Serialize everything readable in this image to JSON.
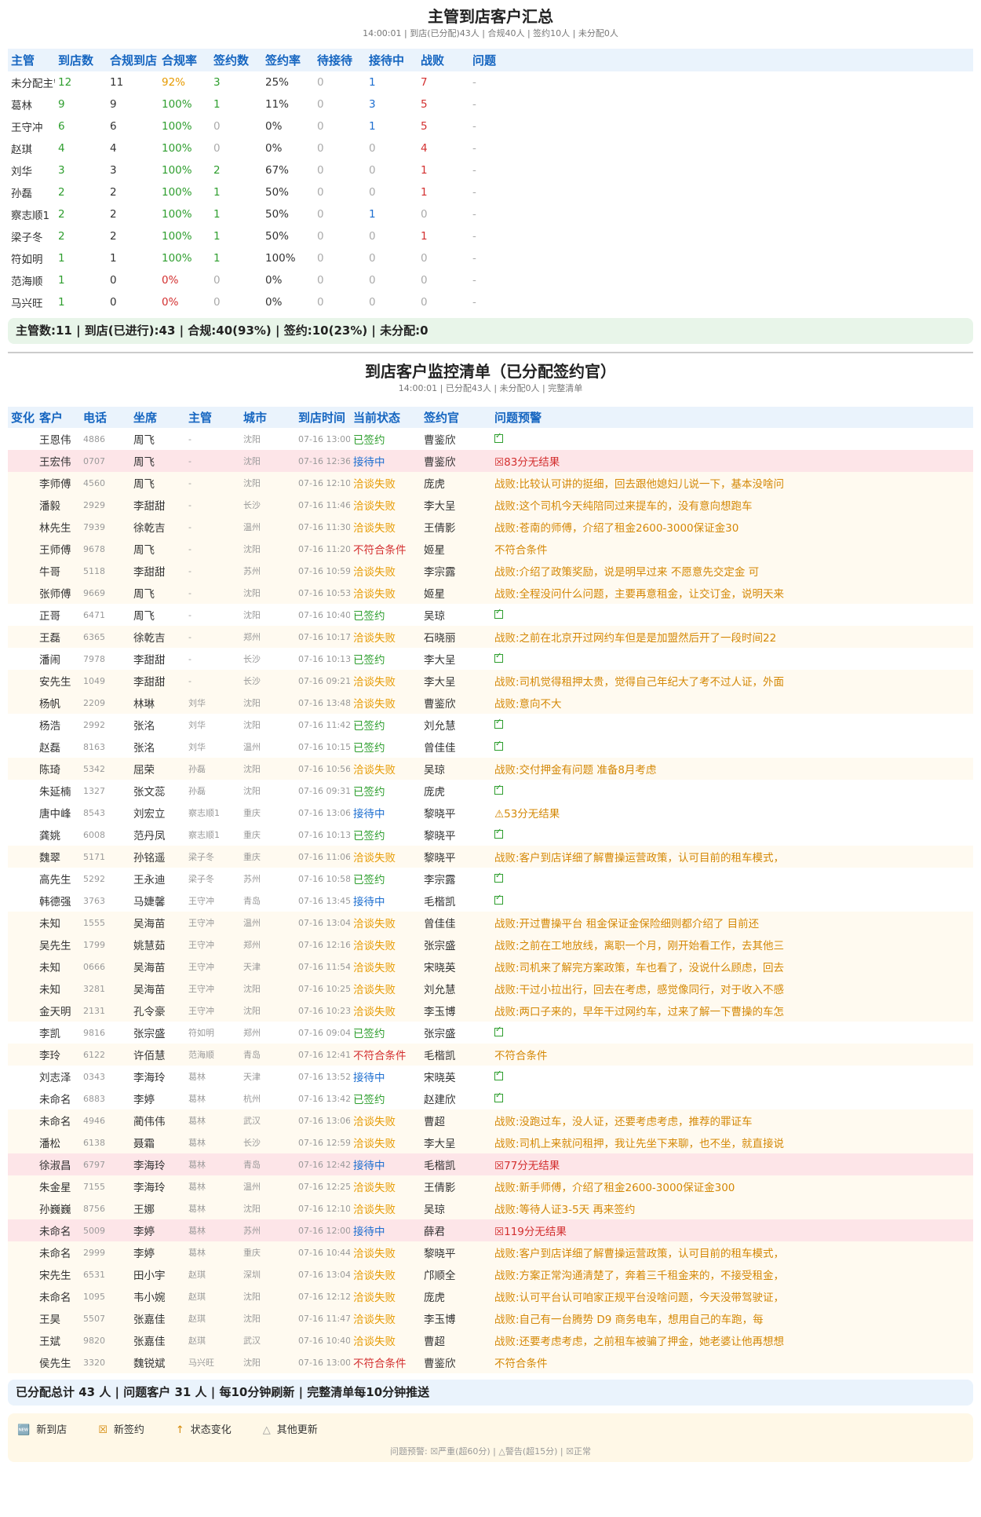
{
  "summary": {
    "title": "主管到店客户汇总",
    "subtitle": "14:00:01 | 到店(已分配)43人 | 合规40人 | 签约10人 | 未分配0人",
    "headers": [
      "主管",
      "到店数",
      "合规到店",
      "合规率",
      "签约数",
      "签约率",
      "待接待",
      "接待中",
      "战败",
      "问题"
    ],
    "rows": [
      [
        "未分配主管",
        "12",
        "11",
        "92%",
        "3",
        "25%",
        "0",
        "1",
        "7",
        "-"
      ],
      [
        "葛林",
        "9",
        "9",
        "100%",
        "1",
        "11%",
        "0",
        "3",
        "5",
        "-"
      ],
      [
        "王守冲",
        "6",
        "6",
        "100%",
        "0",
        "0%",
        "0",
        "1",
        "5",
        "-"
      ],
      [
        "赵琪",
        "4",
        "4",
        "100%",
        "0",
        "0%",
        "0",
        "0",
        "4",
        "-"
      ],
      [
        "刘华",
        "3",
        "3",
        "100%",
        "2",
        "67%",
        "0",
        "0",
        "1",
        "-"
      ],
      [
        "孙磊",
        "2",
        "2",
        "100%",
        "1",
        "50%",
        "0",
        "0",
        "1",
        "-"
      ],
      [
        "察志顺1",
        "2",
        "2",
        "100%",
        "1",
        "50%",
        "0",
        "1",
        "0",
        "-"
      ],
      [
        "梁子冬",
        "2",
        "2",
        "100%",
        "1",
        "50%",
        "0",
        "0",
        "1",
        "-"
      ],
      [
        "符如明",
        "1",
        "1",
        "100%",
        "1",
        "100%",
        "0",
        "0",
        "0",
        "-"
      ],
      [
        "范海顺",
        "1",
        "0",
        "0%",
        "0",
        "0%",
        "0",
        "0",
        "0",
        "-"
      ],
      [
        "马兴旺",
        "1",
        "0",
        "0%",
        "0",
        "0%",
        "0",
        "0",
        "0",
        "-"
      ]
    ],
    "footer": "主管数:11 | 到店(已进行):43 | 合规:40(93%) | 签约:10(23%) | 未分配:0"
  },
  "monitor": {
    "title": "到店客户监控清单（已分配签约官）",
    "subtitle": "14:00:01 | 已分配43人 | 未分配0人 | 完整清单",
    "headers": [
      "变化",
      "客户",
      "电话",
      "坐席",
      "主管",
      "城市",
      "到店时间",
      "当前状态",
      "签约官",
      "问题预警"
    ],
    "rows": [
      [
        "",
        "王恩伟",
        "4886",
        "周飞",
        "-",
        "沈阳",
        "07-16 13:00",
        "已签约",
        "曹鉴欣",
        "",
        "ok"
      ],
      [
        "",
        "王宏伟",
        "0707",
        "周飞",
        "-",
        "沈阳",
        "07-16 12:36",
        "接待中",
        "曹鉴欣",
        "83分无结果",
        "hl"
      ],
      [
        "",
        "李师傅",
        "4560",
        "周飞",
        "-",
        "沈阳",
        "07-16 12:10",
        "洽谈失败",
        "庞虎",
        "战败:比较认可讲的挺细，回去跟他媳妇儿说一下，基本没啥问",
        "alt"
      ],
      [
        "",
        "潘毅",
        "2929",
        "李甜甜",
        "-",
        "长沙",
        "07-16 11:46",
        "洽谈失败",
        "李大呈",
        "战败:这个司机今天纯陪同过来提车的，没有意向想跑车",
        "alt"
      ],
      [
        "",
        "林先生",
        "7939",
        "徐乾吉",
        "-",
        "温州",
        "07-16 11:30",
        "洽谈失败",
        "王倩影",
        "战败:苍南的师傅，介绍了租金2600-3000保证金30",
        "alt"
      ],
      [
        "",
        "王师傅",
        "9678",
        "周飞",
        "-",
        "沈阳",
        "07-16 11:20",
        "不符合条件",
        "姬星",
        "不符合条件",
        "alt"
      ],
      [
        "",
        "牛哥",
        "5118",
        "李甜甜",
        "-",
        "苏州",
        "07-16 10:59",
        "洽谈失败",
        "李宗露",
        "战败:介绍了政策奖励，说是明早过来 不愿意先交定金 可",
        "alt"
      ],
      [
        "",
        "张师傅",
        "9669",
        "周飞",
        "-",
        "沈阳",
        "07-16 10:53",
        "洽谈失败",
        "姬星",
        "战败:全程没问什么问题，主要再意租金，让交订金，说明天来",
        "alt"
      ],
      [
        "",
        "正哥",
        "6471",
        "周飞",
        "-",
        "沈阳",
        "07-16 10:40",
        "已签约",
        "吴琼",
        "",
        "ok"
      ],
      [
        "",
        "王磊",
        "6365",
        "徐乾吉",
        "-",
        "郑州",
        "07-16 10:17",
        "洽谈失败",
        "石晓丽",
        "战败:之前在北京开过网约车但是是加盟然后开了一段时间22",
        "alt"
      ],
      [
        "",
        "潘闹",
        "7978",
        "李甜甜",
        "-",
        "长沙",
        "07-16 10:13",
        "已签约",
        "李大呈",
        "",
        "ok"
      ],
      [
        "",
        "安先生",
        "1049",
        "李甜甜",
        "-",
        "长沙",
        "07-16 09:21",
        "洽谈失败",
        "李大呈",
        "战败:司机觉得租押太贵，觉得自己年纪大了考不过人证，外面",
        "alt"
      ],
      [
        "",
        "杨帆",
        "2209",
        "林琳",
        "刘华",
        "沈阳",
        "07-16 13:48",
        "洽谈失败",
        "曹鉴欣",
        "战败:意向不大",
        "alt"
      ],
      [
        "",
        "杨浩",
        "2992",
        "张洺",
        "刘华",
        "沈阳",
        "07-16 11:42",
        "已签约",
        "刘允慧",
        "",
        "ok"
      ],
      [
        "",
        "赵磊",
        "8163",
        "张洺",
        "刘华",
        "温州",
        "07-16 10:15",
        "已签约",
        "曾佳佳",
        "",
        "ok"
      ],
      [
        "",
        "陈琦",
        "5342",
        "屈荣",
        "孙磊",
        "沈阳",
        "07-16 10:56",
        "洽谈失败",
        "吴琼",
        "战败:交付押金有问题 准备8月考虑",
        "alt"
      ],
      [
        "",
        "朱延楠",
        "1327",
        "张文蕊",
        "孙磊",
        "沈阳",
        "07-16 09:31",
        "已签约",
        "庞虎",
        "",
        "ok"
      ],
      [
        "",
        "唐中峰",
        "8543",
        "刘宏立",
        "察志顺1",
        "重庆",
        "07-16 13:06",
        "接待中",
        "黎晓平",
        "53分无结果",
        "warn"
      ],
      [
        "",
        "龚姚",
        "6008",
        "范丹凤",
        "察志顺1",
        "重庆",
        "07-16 10:13",
        "已签约",
        "黎晓平",
        "",
        "ok"
      ],
      [
        "",
        "魏翠",
        "5171",
        "孙铭遥",
        "梁子冬",
        "重庆",
        "07-16 11:06",
        "洽谈失败",
        "黎晓平",
        "战败:客户到店详细了解曹操运营政策，认可目前的租车模式，",
        "alt"
      ],
      [
        "",
        "高先生",
        "5292",
        "王永迪",
        "梁子冬",
        "苏州",
        "07-16 10:58",
        "已签约",
        "李宗露",
        "",
        "ok"
      ],
      [
        "",
        "韩德强",
        "3763",
        "马婕馨",
        "王守冲",
        "青岛",
        "07-16 13:45",
        "接待中",
        "毛楷凯",
        "",
        "ok"
      ],
      [
        "",
        "未知",
        "1555",
        "吴海苗",
        "王守冲",
        "温州",
        "07-16 13:04",
        "洽谈失败",
        "曾佳佳",
        "战败:开过曹操平台 租金保证金保险细则都介绍了 目前还",
        "alt"
      ],
      [
        "",
        "吴先生",
        "1799",
        "姚慧茹",
        "王守冲",
        "郑州",
        "07-16 12:16",
        "洽谈失败",
        "张宗盛",
        "战败:之前在工地放线，离职一个月，刚开始看工作，去其他三",
        "alt"
      ],
      [
        "",
        "未知",
        "0666",
        "吴海苗",
        "王守冲",
        "天津",
        "07-16 11:54",
        "洽谈失败",
        "宋晓英",
        "战败:司机来了解完方案政策，车也看了，没说什么顾虑，回去",
        "alt"
      ],
      [
        "",
        "未知",
        "3281",
        "吴海苗",
        "王守冲",
        "沈阳",
        "07-16 10:25",
        "洽谈失败",
        "刘允慧",
        "战败:干过小拉出行，回去在考虑，感觉像同行，对于收入不感",
        "alt"
      ],
      [
        "",
        "金天明",
        "2131",
        "孔令豪",
        "王守冲",
        "沈阳",
        "07-16 10:23",
        "洽谈失败",
        "李玉博",
        "战败:两口子来的，早年干过网约车，过来了解一下曹操的车怎",
        "alt"
      ],
      [
        "",
        "李凯",
        "9816",
        "张宗盛",
        "符如明",
        "郑州",
        "07-16 09:04",
        "已签约",
        "张宗盛",
        "",
        "ok"
      ],
      [
        "",
        "李玲",
        "6122",
        "许佰慧",
        "范海顺",
        "青岛",
        "07-16 12:41",
        "不符合条件",
        "毛楷凯",
        "不符合条件",
        "alt"
      ],
      [
        "",
        "刘志泽",
        "0343",
        "李海玲",
        "葛林",
        "天津",
        "07-16 13:52",
        "接待中",
        "宋晓英",
        "",
        "ok"
      ],
      [
        "",
        "未命名",
        "6883",
        "李婷",
        "葛林",
        "杭州",
        "07-16 13:42",
        "已签约",
        "赵建欣",
        "",
        "ok"
      ],
      [
        "",
        "未命名",
        "4946",
        "蔺伟伟",
        "葛林",
        "武汉",
        "07-16 13:06",
        "洽谈失败",
        "曹超",
        "战败:没跑过车，没人证，还要考虑考虑，推荐的罪证车",
        "alt"
      ],
      [
        "",
        "潘松",
        "6138",
        "聂霜",
        "葛林",
        "长沙",
        "07-16 12:59",
        "洽谈失败",
        "李大呈",
        "战败:司机上来就问租押，我让先坐下来聊，也不坐，就直接说",
        "alt"
      ],
      [
        "",
        "徐淑昌",
        "6797",
        "李海玲",
        "葛林",
        "青岛",
        "07-16 12:42",
        "接待中",
        "毛楷凯",
        "77分无结果",
        "hl"
      ],
      [
        "",
        "朱金星",
        "7155",
        "李海玲",
        "葛林",
        "温州",
        "07-16 12:25",
        "洽谈失败",
        "王倩影",
        "战败:新手师傅，介绍了租金2600-3000保证金300",
        "alt"
      ],
      [
        "",
        "孙巍巍",
        "8756",
        "王娜",
        "葛林",
        "沈阳",
        "07-16 12:10",
        "洽谈失败",
        "吴琼",
        "战败:等待人证3-5天 再来签约",
        "alt"
      ],
      [
        "",
        "未命名",
        "5009",
        "李婷",
        "葛林",
        "苏州",
        "07-16 12:00",
        "接待中",
        "薛君",
        "119分无结果",
        "hl"
      ],
      [
        "",
        "未命名",
        "2999",
        "李婷",
        "葛林",
        "重庆",
        "07-16 10:44",
        "洽谈失败",
        "黎晓平",
        "战败:客户到店详细了解曹操运营政策，认可目前的租车模式，",
        "alt"
      ],
      [
        "",
        "宋先生",
        "6531",
        "田小宇",
        "赵琪",
        "深圳",
        "07-16 13:04",
        "洽谈失败",
        "邝顺全",
        "战败:方案正常沟通清楚了，奔着三千租金来的，不接受租金，",
        "alt"
      ],
      [
        "",
        "未命名",
        "1095",
        "韦小婉",
        "赵琪",
        "沈阳",
        "07-16 12:12",
        "洽谈失败",
        "庞虎",
        "战败:认可平台认可咱家正规平台没啥问题，今天没带驾驶证，",
        "alt"
      ],
      [
        "",
        "王昊",
        "5507",
        "张嘉佳",
        "赵琪",
        "沈阳",
        "07-16 11:47",
        "洽谈失败",
        "李玉博",
        "战败:自己有一台腾势 D9 商务电车，想用自己的车跑，每",
        "alt"
      ],
      [
        "",
        "王斌",
        "9820",
        "张嘉佳",
        "赵琪",
        "武汉",
        "07-16 10:40",
        "洽谈失败",
        "曹超",
        "战败:还要考虑考虑，之前租车被骗了押金，她老婆让他再想想",
        "alt"
      ],
      [
        "",
        "侯先生",
        "3320",
        "魏锐斌",
        "马兴旺",
        "沈阳",
        "07-16 13:00",
        "不符合条件",
        "曹鉴欣",
        "不符合条件",
        "alt"
      ]
    ],
    "footer": "已分配总计 43 人 | 问题客户 31 人 | 每10分钟刷新 | 完整清单每10分钟推送"
  },
  "legend": {
    "items": [
      {
        "icon": "🆕",
        "label": "新到店"
      },
      {
        "icon": "☒",
        "label": "新签约"
      },
      {
        "icon": "↑",
        "label": "状态变化"
      },
      {
        "icon": "△",
        "label": "其他更新"
      }
    ],
    "note": "问题预警: ☒严重(超60分) | △警告(超15分) | ☒正常"
  }
}
